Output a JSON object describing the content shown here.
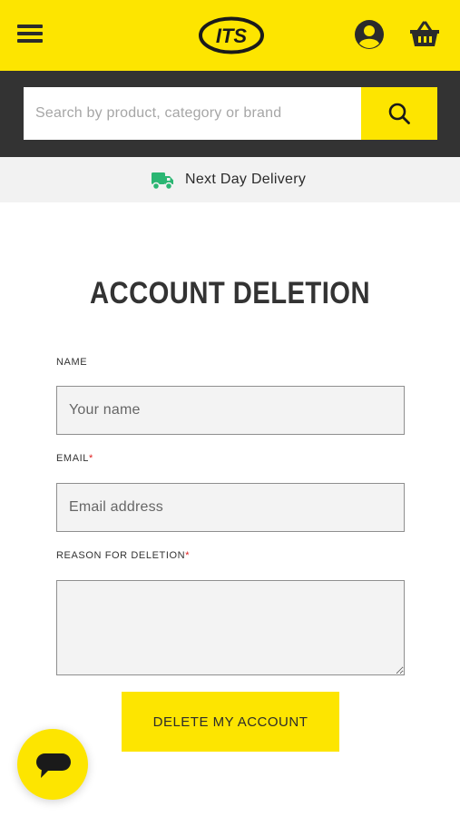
{
  "header": {
    "logo_text": "ITS",
    "menu_icon": "hamburger-menu-icon",
    "account_icon": "user-account-icon",
    "basket_icon": "shopping-basket-icon"
  },
  "search": {
    "placeholder": "Search by product, category or brand",
    "value": "",
    "button_icon": "search-icon"
  },
  "delivery": {
    "icon": "delivery-truck-icon",
    "text": "Next Day Delivery"
  },
  "form": {
    "title": "ACCOUNT DELETION",
    "name_label": "NAME",
    "name_placeholder": "Your name",
    "name_value": "",
    "email_label": "EMAIL",
    "email_required": "*",
    "email_placeholder": "Email address",
    "email_value": "",
    "reason_label": "REASON FOR DELETION",
    "reason_required": "*",
    "reason_value": "",
    "submit_label": "DELETE MY ACCOUNT"
  },
  "chat": {
    "icon": "chat-bubble-icon"
  },
  "colors": {
    "brand_yellow": "#fde500",
    "dark_bar": "#333333",
    "delivery_green": "#2bb673",
    "required_red": "#e02020"
  }
}
